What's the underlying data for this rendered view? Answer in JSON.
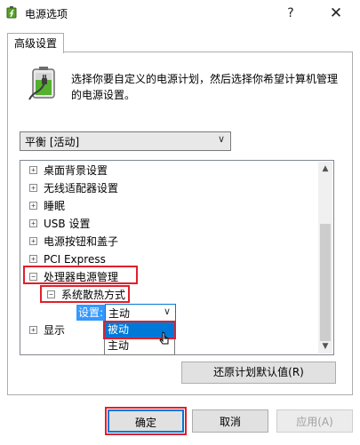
{
  "window": {
    "title": "电源选项",
    "help_label": "?",
    "close_label": "✕"
  },
  "tabs": [
    {
      "label": "高级设置"
    }
  ],
  "description": "选择你要自定义的电源计划，然后选择你希望计算机管理的电源设置。",
  "plan_select": {
    "value": "平衡 [活动]"
  },
  "tree": {
    "items": [
      {
        "label": "桌面背景设置",
        "expander": "+"
      },
      {
        "label": "无线适配器设置",
        "expander": "+"
      },
      {
        "label": "睡眠",
        "expander": "+"
      },
      {
        "label": "USB 设置",
        "expander": "+"
      },
      {
        "label": "电源按钮和盖子",
        "expander": "+"
      },
      {
        "label": "PCI Express",
        "expander": "+"
      },
      {
        "label": "处理器电源管理",
        "expander": "−"
      },
      {
        "label": "系统散热方式",
        "expander": "−"
      },
      {
        "label": "显示",
        "expander": "+"
      }
    ],
    "setting_label": "设置:",
    "setting_value": "主动",
    "dropdown_options": [
      "被动",
      "主动"
    ],
    "selected_option": "被动"
  },
  "buttons": {
    "restore": "还原计划默认值(R)",
    "ok": "确定",
    "cancel": "取消",
    "apply": "应用(A)"
  },
  "colors": {
    "highlight_box": "#e0202a",
    "selection": "#3399ff",
    "focus_border": "#0078d7"
  }
}
